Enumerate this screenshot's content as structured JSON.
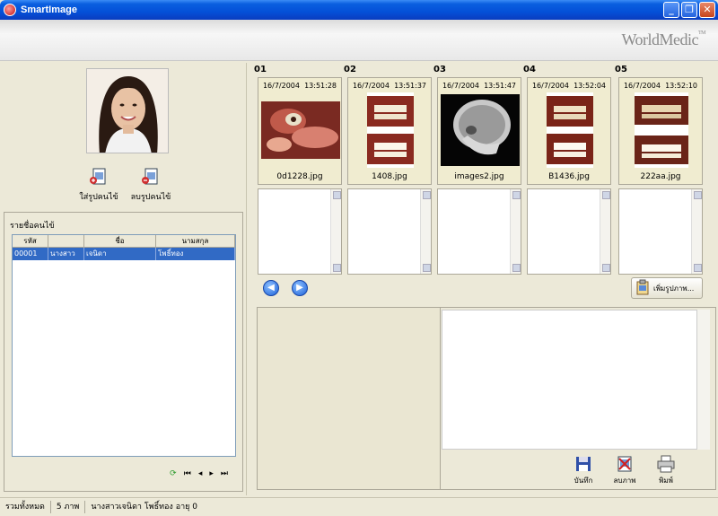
{
  "window": {
    "title": "SmartImage",
    "min": "_",
    "max": "❐",
    "close": "✕"
  },
  "brand": {
    "name": "WorldMedic",
    "mark": "TM"
  },
  "patient_buttons": {
    "add_label": "ใส่รูปคนไข้",
    "delete_label": "ลบรูปคนไข้"
  },
  "patient_list": {
    "caption": "รายชื่อคนไข้",
    "columns": [
      "รหัส",
      "",
      "ชื่อ",
      "นามสกุล"
    ],
    "rows": [
      {
        "code": "00001",
        "prefix": "นางสาว",
        "first": "เจนิดา",
        "last": "โพธิ์ทอง"
      }
    ],
    "nav": {
      "refresh": "⟳",
      "first": "⏮",
      "prev": "◂",
      "next": "▸",
      "last": "⏭"
    }
  },
  "thumbnails": [
    {
      "num": "01",
      "date": "16/7/2004",
      "time": "13:51:28",
      "file": "0d1228.jpg",
      "kind": "intraoral"
    },
    {
      "num": "02",
      "date": "16/7/2004",
      "time": "13:51:37",
      "file": "1408.jpg",
      "kind": "before-after"
    },
    {
      "num": "03",
      "date": "16/7/2004",
      "time": "13:51:47",
      "file": "images2.jpg",
      "kind": "xray"
    },
    {
      "num": "04",
      "date": "16/7/2004",
      "time": "13:52:04",
      "file": "B1436.jpg",
      "kind": "before-after"
    },
    {
      "num": "05",
      "date": "16/7/2004",
      "time": "13:52:10",
      "file": "222aa.jpg",
      "kind": "before-after"
    }
  ],
  "nav_arrows": {
    "prev": "◀",
    "next": "▶"
  },
  "add_image_button": "เพิ่มรูปภาพ...",
  "actions": {
    "save": "บันทึก",
    "delete": "ลบภาพ",
    "print": "พิมพ์"
  },
  "status": {
    "total_label": "รวมทั้งหมด",
    "total_value": "5 ภาพ",
    "patient": "นางสาวเจนิดา โพธิ์ทอง อายุ 0"
  }
}
